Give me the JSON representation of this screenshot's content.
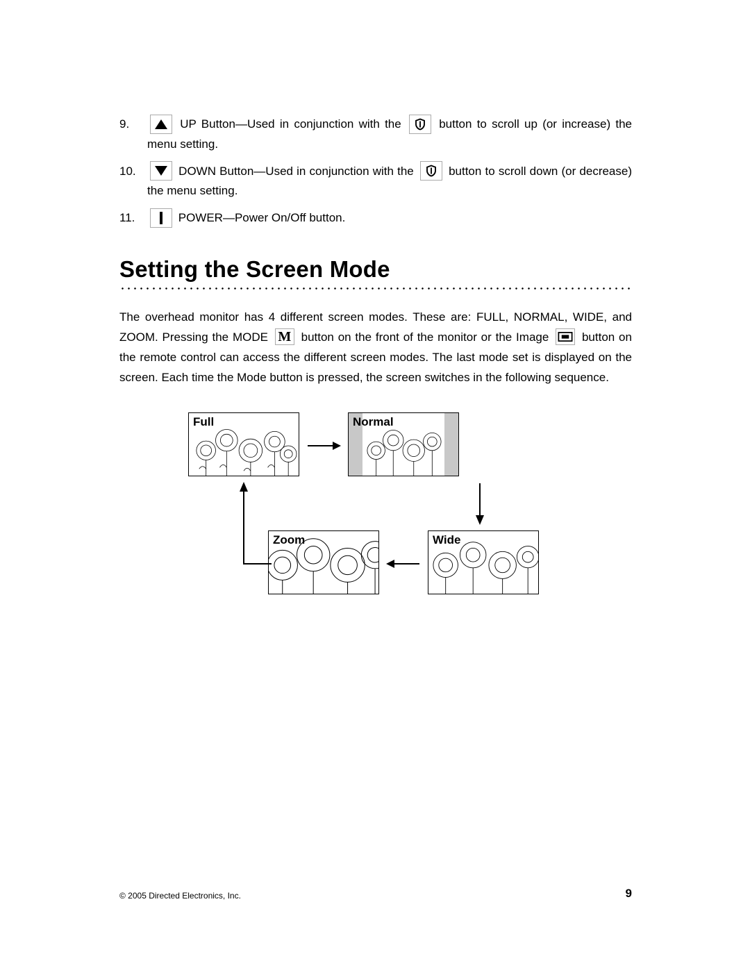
{
  "list": {
    "items": [
      {
        "num": "9.",
        "icon": "up",
        "pre": "UP Button—Used in conjunction with the",
        "mid_icon": "shield",
        "post": "button to scroll up (or increase) the menu setting."
      },
      {
        "num": "10.",
        "icon": "down",
        "pre": "DOWN Button—Used in conjunction with the",
        "mid_icon": "shield",
        "post": "button to scroll down (or decrease) the menu setting."
      },
      {
        "num": "11.",
        "icon": "power",
        "pre": "POWER—Power On/Off button.",
        "mid_icon": "",
        "post": ""
      }
    ]
  },
  "heading": "Setting the Screen Mode",
  "para": {
    "s1": "The overhead monitor has 4 different screen modes. These are: FULL, NORMAL, WIDE, and ZOOM. Pressing the MODE",
    "s2": "button on the front of the monitor or the Image",
    "s3": "button on the remote control can access the different screen modes. The last mode set is displayed on the screen. Each time the Mode button is pressed, the screen switches in the following sequence."
  },
  "diagram": {
    "full": "Full",
    "normal": "Normal",
    "wide": "Wide",
    "zoom": "Zoom"
  },
  "footer": {
    "copyright": "© 2005 Directed Electronics, Inc.",
    "page": "9"
  }
}
